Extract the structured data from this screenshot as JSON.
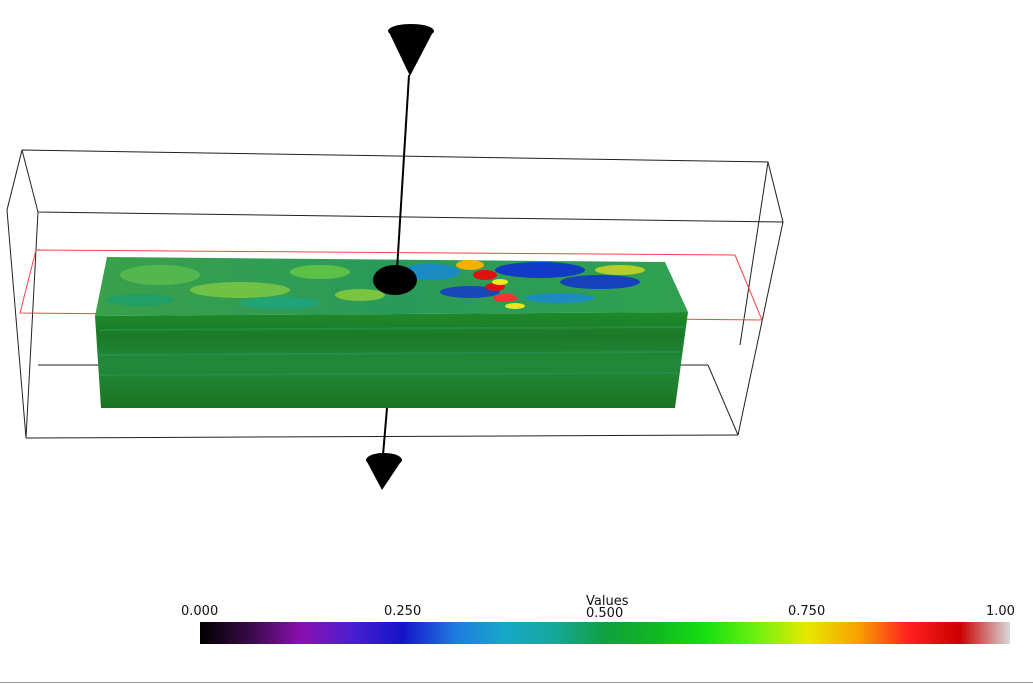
{
  "colorbar": {
    "title": "Values",
    "ticks": [
      "0.000",
      "0.250",
      "0.500",
      "0.750",
      "1.00"
    ],
    "stops": [
      "#000000",
      "#3a0a4a",
      "#8a10b0",
      "#4a1fd0",
      "#1414c8",
      "#1f78e0",
      "#17a8c8",
      "#14a89a",
      "#11a040",
      "#10b820",
      "#16e010",
      "#70f010",
      "#e8e800",
      "#f8a000",
      "#ff2020",
      "#cc0000",
      "#d8d8d8"
    ]
  },
  "colors": {
    "volume_front": "#1d7a1d",
    "volume_top": "#2a9a3a",
    "hot": "#e01010",
    "cold": "#1030d0",
    "outline": "#202020",
    "clip_plane": "#ff4040",
    "widget": "#000000"
  }
}
